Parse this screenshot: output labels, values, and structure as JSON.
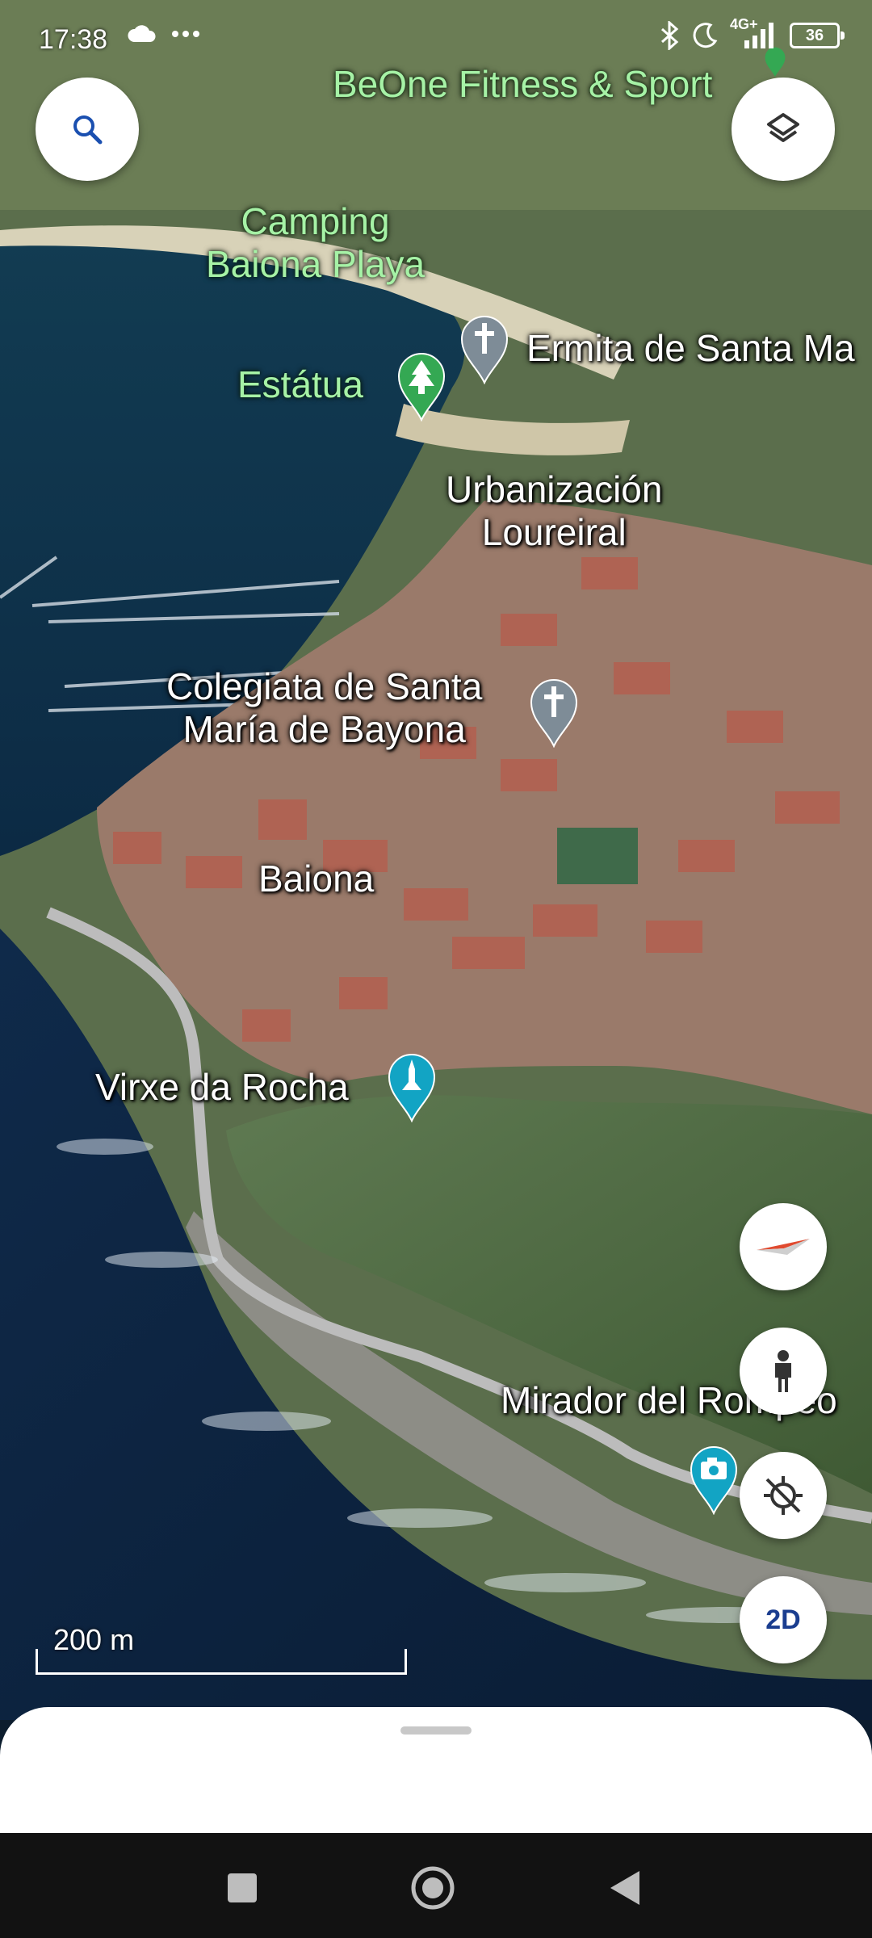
{
  "status_bar": {
    "time": "17:38",
    "network": "4G+",
    "battery": "36",
    "icons": [
      "cloud-icon",
      "more-dots-icon",
      "bluetooth-icon",
      "do-not-disturb-moon-icon",
      "signal-icon",
      "battery-icon"
    ]
  },
  "map": {
    "places": {
      "beone": "BeOne Fitness & Sport",
      "camping_line1": "Camping",
      "camping_line2": "Baiona Playa",
      "ermita": "Ermita de Santa Ma",
      "estatua": "Estátua",
      "urbanizacion_line1": "Urbanización",
      "urbanizacion_line2": "Loureiral",
      "colegiata_line1": "Colegiata de Santa",
      "colegiata_line2": "María de Bayona",
      "baiona": "Baiona",
      "virxe": "Virxe da Rocha",
      "mirador": "Mirador del Rompeo"
    },
    "pin_icons": {
      "estatua": "park-tree-icon",
      "ermita": "church-cross-icon",
      "colegiata": "church-cross-icon",
      "virxe": "monument-icon",
      "mirador": "camera-viewpoint-icon",
      "beone": "fitness-icon"
    },
    "colors": {
      "park_pin": "#34a853",
      "church_pin": "#7e8c97",
      "monument_pin": "#12a4c4",
      "label_green": "#a6f2a6"
    }
  },
  "controls": {
    "search_icon": "search-icon",
    "layers_icon": "layers-icon",
    "compass_icon": "compass-icon",
    "street_view_icon": "pegman-icon",
    "location_icon": "location-disabled-icon",
    "toggle_2d": "2D"
  },
  "scale": {
    "label": "200 m"
  },
  "nav_bar": {
    "buttons": [
      "recents-square-icon",
      "home-circle-icon",
      "back-triangle-icon"
    ]
  }
}
